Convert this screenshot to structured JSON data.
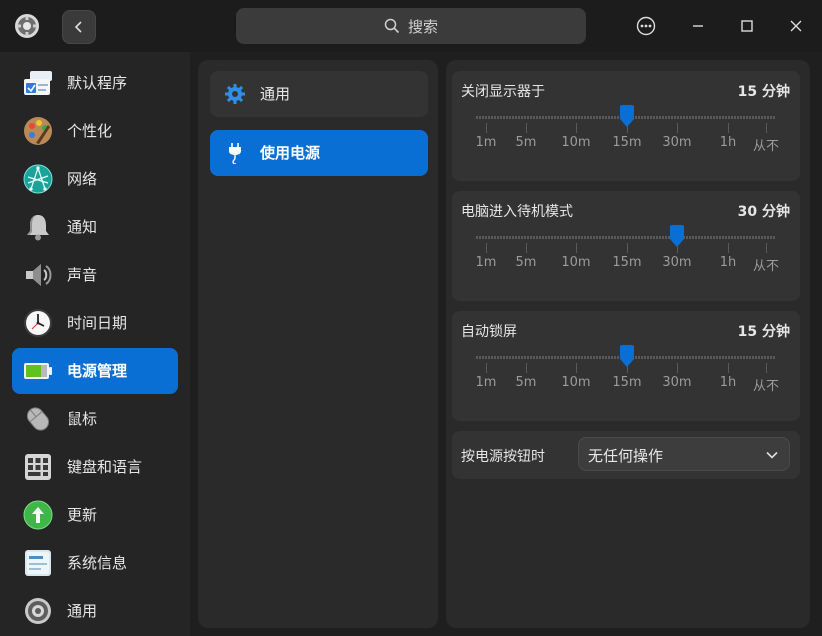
{
  "titlebar": {
    "search_placeholder": "搜索"
  },
  "sidebar": {
    "items": [
      {
        "label": "默认程序"
      },
      {
        "label": "个性化"
      },
      {
        "label": "网络"
      },
      {
        "label": "通知"
      },
      {
        "label": "声音"
      },
      {
        "label": "时间日期"
      },
      {
        "label": "电源管理"
      },
      {
        "label": "鼠标"
      },
      {
        "label": "键盘和语言"
      },
      {
        "label": "更新"
      },
      {
        "label": "系统信息"
      },
      {
        "label": "通用"
      }
    ],
    "active_index": 6
  },
  "middle": {
    "items": [
      {
        "label": "通用"
      },
      {
        "label": "使用电源"
      }
    ]
  },
  "power": {
    "tick_labels": [
      "1m",
      "5m",
      "10m",
      "15m",
      "30m",
      "1h",
      "从不"
    ],
    "monitor_off": {
      "title": "关闭显示器于",
      "value": "15 分钟",
      "selected_index": 3
    },
    "standby": {
      "title": "电脑进入待机模式",
      "value": "30 分钟",
      "selected_index": 4
    },
    "auto_lock": {
      "title": "自动锁屏",
      "value": "15 分钟",
      "selected_index": 3
    },
    "power_button": {
      "title": "按电源按钮时",
      "value": "无任何操作"
    }
  },
  "colors": {
    "accent": "#0a6fd4"
  }
}
